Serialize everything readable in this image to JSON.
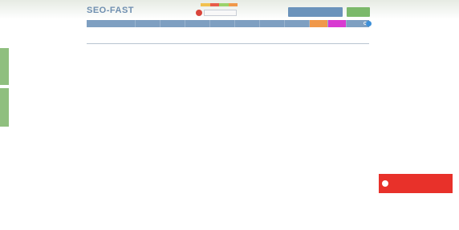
{
  "header": {
    "logo_text": "SEO-FAST",
    "logo_badge": "",
    "city_value": "",
    "register_label": "",
    "login_label": "",
    "promo_colors": [
      "#f2c14e",
      "#e85d4a",
      "#9bd36b",
      "#f0984a"
    ]
  },
  "nav": {
    "items": [
      {
        "label": "",
        "highlight": ""
      },
      {
        "label": "",
        "highlight": ""
      },
      {
        "label": "",
        "highlight": ""
      },
      {
        "label": "",
        "highlight": ""
      },
      {
        "label": "",
        "highlight": ""
      },
      {
        "label": "",
        "highlight": ""
      },
      {
        "label": "",
        "highlight": ""
      },
      {
        "label": "",
        "highlight": ""
      },
      {
        "label": "",
        "highlight": "orange"
      },
      {
        "label": "",
        "highlight": "magenta"
      }
    ]
  },
  "content": {
    "breadcrumb": "",
    "heading": ""
  },
  "side_tabs": [
    {
      "label": ""
    },
    {
      "label": ""
    }
  ],
  "toast": {
    "text": ""
  },
  "colors": {
    "nav_bg": "#7e9fc1",
    "register_bg": "#6b93bb",
    "login_bg": "#7bb96a",
    "side_tab_bg": "#8fbf7e",
    "toast_bg": "#e8312a",
    "orange": "#f0984a",
    "magenta": "#d83ad1"
  }
}
